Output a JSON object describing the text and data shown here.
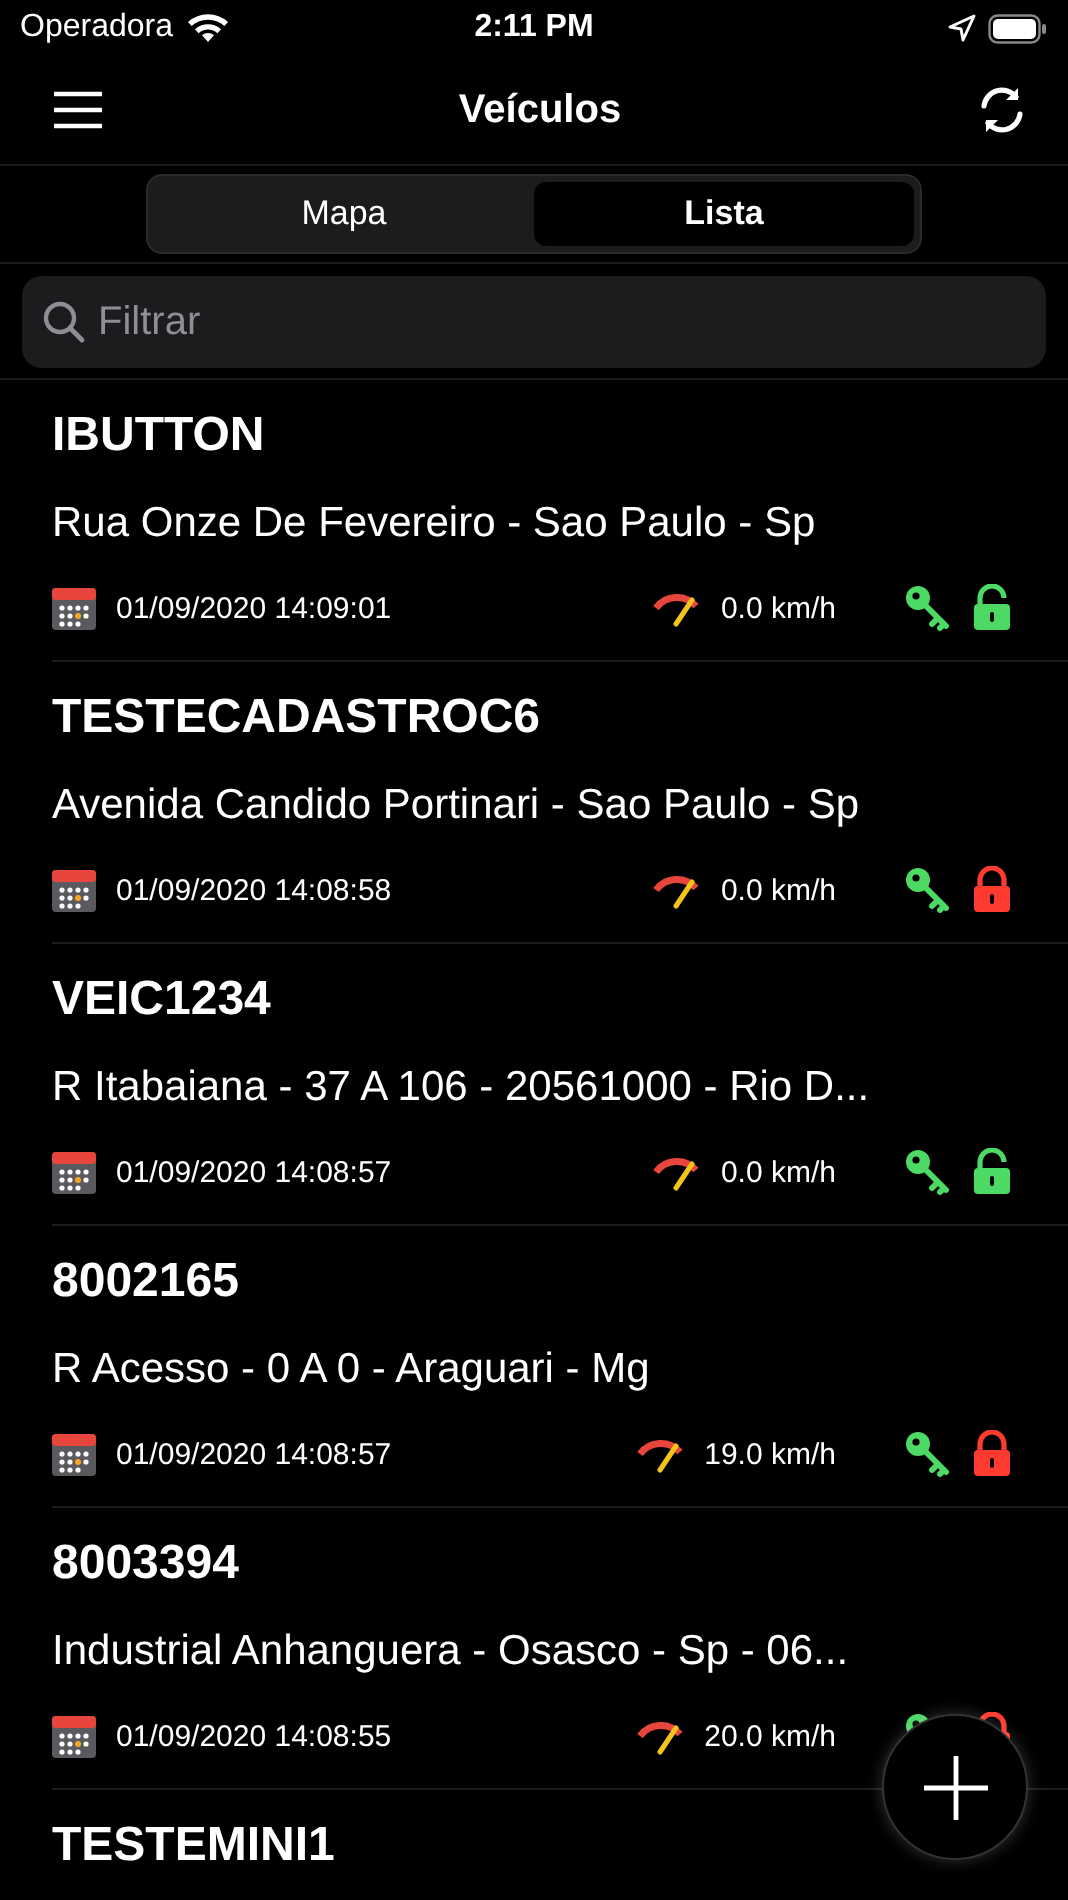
{
  "status_bar": {
    "carrier": "Operadora",
    "time": "2:11 PM"
  },
  "nav": {
    "title": "Veículos"
  },
  "tabs": [
    {
      "label": "Mapa",
      "selected": false
    },
    {
      "label": "Lista",
      "selected": true
    }
  ],
  "search": {
    "placeholder": "Filtrar"
  },
  "vehicles": [
    {
      "name": "IBUTTON",
      "address": "Rua Onze De Fevereiro - Sao Paulo - Sp",
      "datetime": "01/09/2020 14:09:01",
      "speed": "0.0 km/h",
      "ignition": true,
      "locked": false
    },
    {
      "name": "TESTECADASTROC6",
      "address": "Avenida Candido Portinari - Sao Paulo - Sp",
      "datetime": "01/09/2020 14:08:58",
      "speed": "0.0 km/h",
      "ignition": true,
      "locked": true
    },
    {
      "name": "VEIC1234",
      "address": "R Itabaiana - 37 A 106 - 20561000 - Rio D...",
      "datetime": "01/09/2020 14:08:57",
      "speed": "0.0 km/h",
      "ignition": true,
      "locked": false
    },
    {
      "name": "8002165",
      "address": "R Acesso - 0 A 0 - Araguari - Mg",
      "datetime": "01/09/2020 14:08:57",
      "speed": "19.0 km/h",
      "ignition": true,
      "locked": true
    },
    {
      "name": "8003394",
      "address": "Industrial Anhanguera - Osasco - Sp - 06...",
      "datetime": "01/09/2020 14:08:55",
      "speed": "20.0 km/h",
      "ignition": true,
      "locked": true
    },
    {
      "name": "TESTEMINI1"
    }
  ]
}
